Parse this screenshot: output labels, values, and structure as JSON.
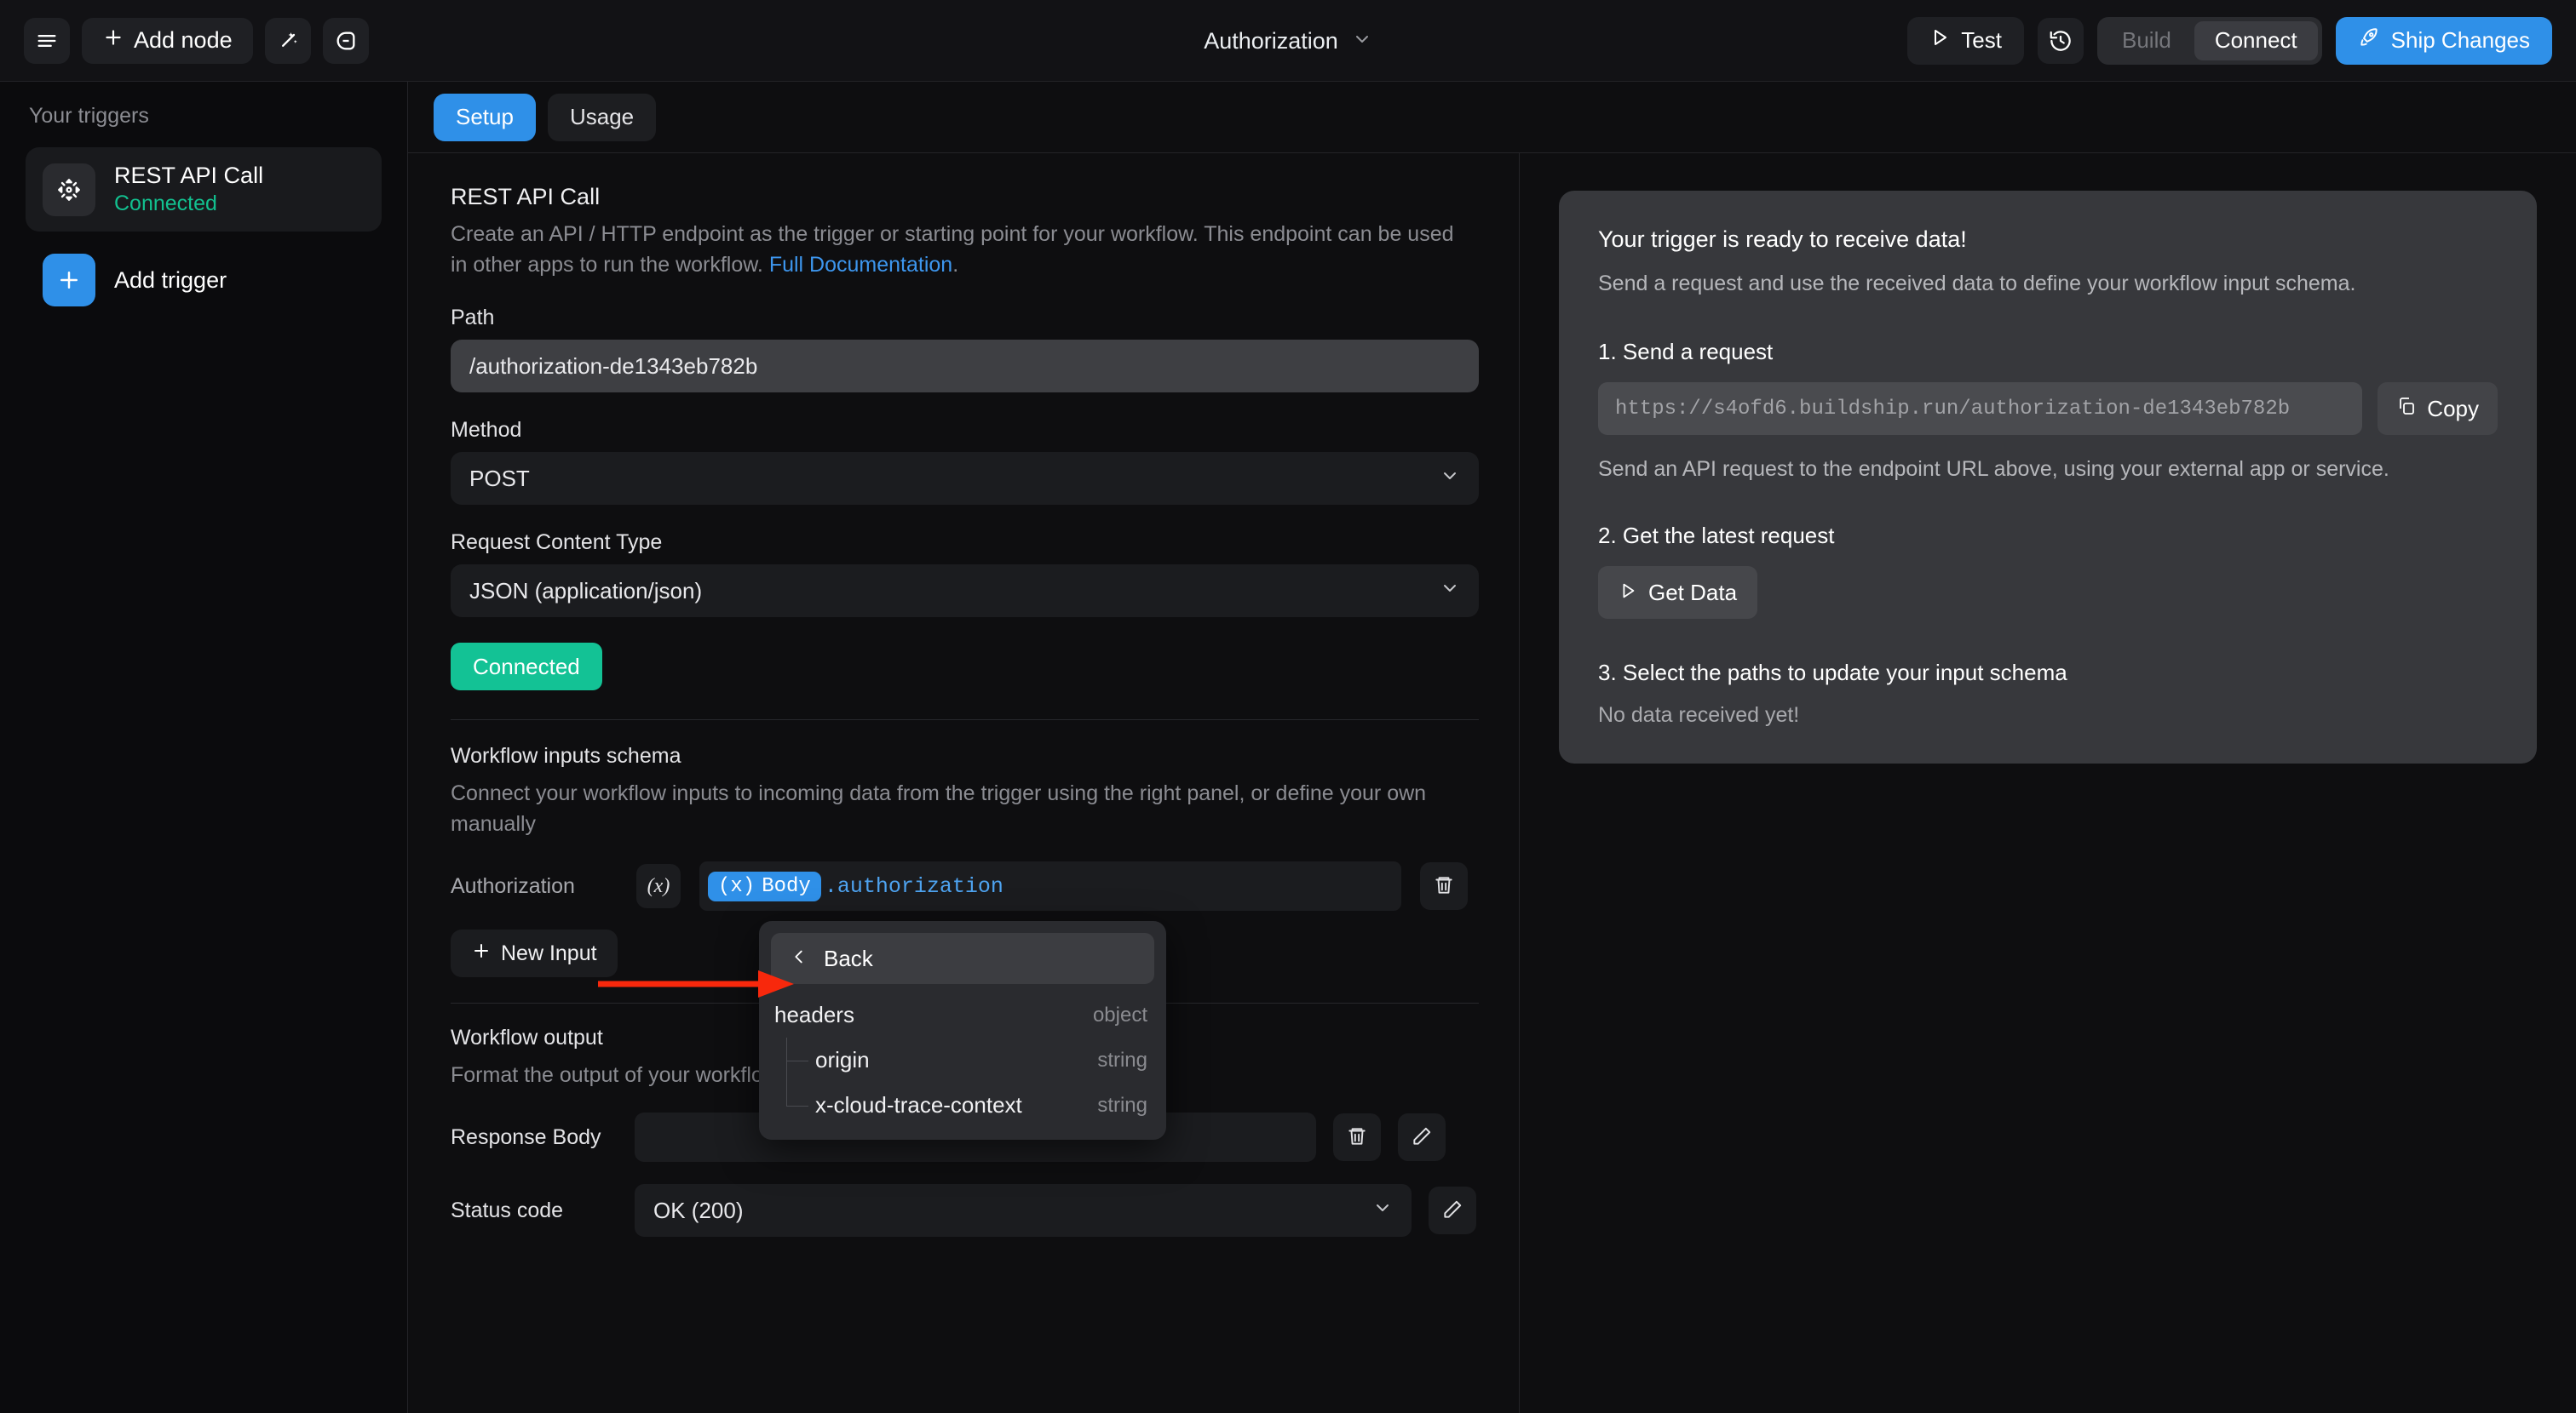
{
  "topbar": {
    "menu_icon": "hamburger-icon",
    "add_node_label": "Add node",
    "magic_icon": "magic-wand-icon",
    "comment_icon": "comment-icon",
    "workflow_title": "Authorization",
    "test_label": "Test",
    "history_icon": "history-icon",
    "segments": [
      {
        "label": "Build",
        "active": false
      },
      {
        "label": "Connect",
        "active": true
      }
    ],
    "ship_label": "Ship Changes"
  },
  "sidebar": {
    "heading": "Your triggers",
    "trigger": {
      "name": "REST API Call",
      "status": "Connected"
    },
    "add_trigger_label": "Add trigger"
  },
  "tabs": [
    {
      "label": "Setup",
      "active": true
    },
    {
      "label": "Usage",
      "active": false
    }
  ],
  "form": {
    "section_title": "REST API Call",
    "section_desc_1": "Create an API / HTTP endpoint as the trigger or starting point for your workflow. This endpoint can be used in other apps to run the workflow. ",
    "section_link": "Full Documentation",
    "section_desc_2": ".",
    "path_label": "Path",
    "path_value": "/authorization-de1343eb782b",
    "method_label": "Method",
    "method_value": "POST",
    "content_type_label": "Request Content Type",
    "content_type_value": "JSON (application/json)",
    "connected_badge": "Connected",
    "inputs_schema_title": "Workflow inputs schema",
    "inputs_schema_desc": "Connect your workflow inputs to incoming data from the trigger using the right panel, or define your own manually",
    "auth_row_label": "Authorization",
    "fx_label": "(x)",
    "expr_chip_prefix": "(x)",
    "expr_chip_label": "Body",
    "expr_tail": ".authorization",
    "delete_icon": "trash-icon",
    "new_input_label": "New Input",
    "output_title": "Workflow output",
    "output_desc": "Format the output of your workflow",
    "response_body_label": "Response Body",
    "response_body_value": "",
    "status_code_label": "Status code",
    "status_code_value": "OK (200)",
    "edit_icon": "pencil-icon"
  },
  "dropdown": {
    "back_label": "Back",
    "rows": [
      {
        "name": "headers",
        "type": "object",
        "child": false
      },
      {
        "name": "origin",
        "type": "string",
        "child": true
      },
      {
        "name": "x-cloud-trace-context",
        "type": "string",
        "child": true
      }
    ]
  },
  "right_panel": {
    "card_title": "Your trigger is ready to receive data!",
    "card_sub": "Send a request and use the received data to define your workflow input schema.",
    "step1_title": "1. Send a request",
    "endpoint_url": "https://s4ofd6.buildship.run/authorization-de1343eb782b",
    "copy_label": "Copy",
    "step1_note": "Send an API request to the endpoint URL above, using your external app or service.",
    "step2_title": "2. Get the latest request",
    "get_data_label": "Get Data",
    "step3_title": "3. Select the paths to update your input schema",
    "no_data": "No data received yet!"
  },
  "colors": {
    "accent_blue": "#2f90e8",
    "connected_green": "#13c295",
    "annotation_red": "#f8280c"
  }
}
